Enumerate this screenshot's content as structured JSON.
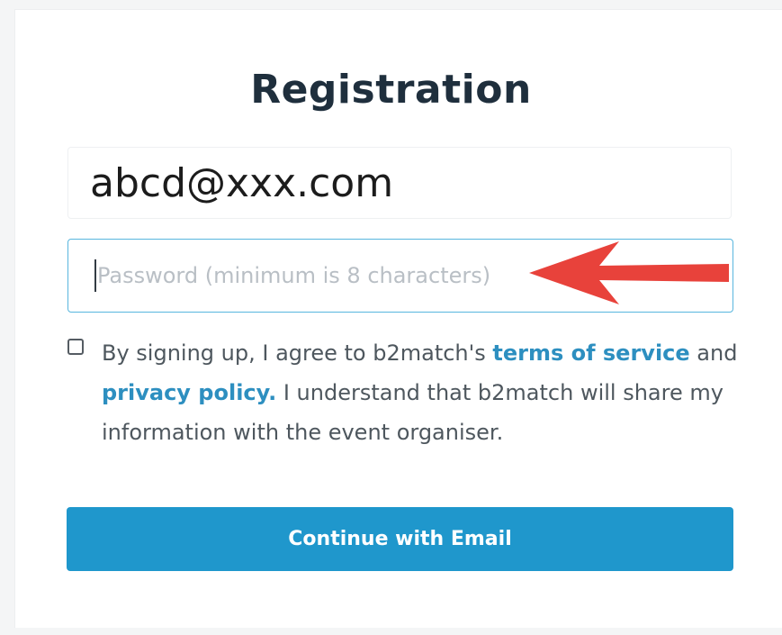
{
  "form": {
    "title": "Registration",
    "email": {
      "value": "abcd@xxx.com"
    },
    "password": {
      "value": "",
      "placeholder": "Password (minimum is 8 characters)"
    },
    "agreement": {
      "checked": false,
      "text_before": "By signing up, I agree to b2match's ",
      "terms_link": "terms of service",
      "text_middle": " and ",
      "privacy_link": "privacy policy.",
      "text_after": " I understand that b2match will share my information with the event organiser."
    },
    "continue_label": "Continue with Email"
  },
  "colors": {
    "title": "#1f2f3d",
    "accent": "#1f97cc",
    "link": "#2d8fc0",
    "focus_border": "#58b6de",
    "annotation_arrow": "#e8423b"
  },
  "icons": {
    "annotation": "red-arrow-left-icon"
  }
}
